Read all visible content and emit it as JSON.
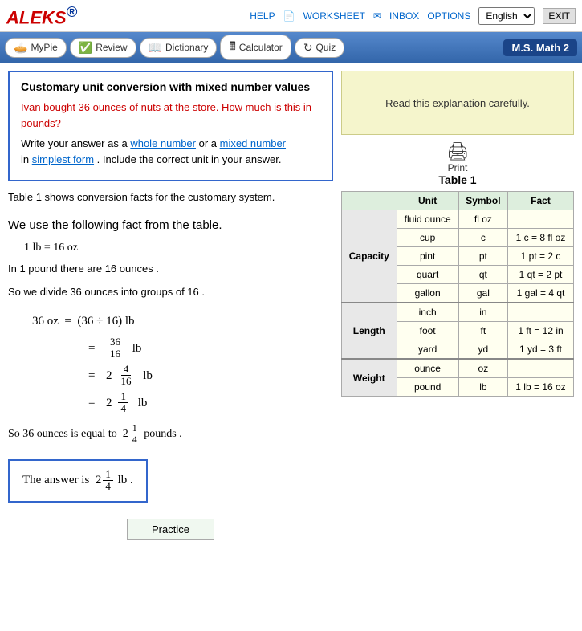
{
  "header": {
    "logo": "ALEKS",
    "logo_superscript": "®",
    "links": {
      "help": "HELP",
      "worksheet": "WORKSHEET",
      "inbox": "INBOX",
      "options": "OPTIONS",
      "exit": "EXIT"
    },
    "language": "English"
  },
  "navbar": {
    "mypie": "MyPie",
    "review": "Review",
    "dictionary": "Dictionary",
    "calculator": "Calculator",
    "quiz": "Quiz",
    "course": "M.S. Math 2"
  },
  "problem": {
    "title": "Customary unit conversion with mixed number values",
    "body": "Ivan bought 36 ounces of nuts at the store. How much is this in pounds?",
    "instruction1": "Write your answer as a",
    "whole_number_link": "whole number",
    "or": "or a",
    "mixed_number_link": "mixed number",
    "instruction2": "in",
    "simplest_form_link": "simplest form",
    "instruction3": ". Include the correct unit in your answer."
  },
  "explanation": {
    "text": "Read this explanation carefully."
  },
  "print": {
    "label": "Print"
  },
  "content": {
    "table_ref": "Table 1 shows conversion facts for the customary system.",
    "fact_intro": "We use the following fact from the table.",
    "fact": "1 lb = 16 oz",
    "line1": "In 1 pound there are 16 ounces .",
    "line2": "So we divide 36 ounces into groups of 16 .",
    "conclusion": "So 36 ounces is equal to",
    "conclusion2": "pounds .",
    "answer_label": "The answer is",
    "answer_unit": "lb .",
    "practice_label": "Practice"
  },
  "table1": {
    "title": "Table 1",
    "headers": [
      "Unit",
      "Symbol",
      "Fact"
    ],
    "categories": {
      "capacity": {
        "label": "Capacity",
        "rows": [
          {
            "unit": "fluid ounce",
            "symbol": "fl oz",
            "fact": ""
          },
          {
            "unit": "cup",
            "symbol": "c",
            "fact": "1 c = 8 fl oz"
          },
          {
            "unit": "pint",
            "symbol": "pt",
            "fact": "1 pt = 2 c"
          },
          {
            "unit": "quart",
            "symbol": "qt",
            "fact": "1 qt = 2 pt"
          },
          {
            "unit": "gallon",
            "symbol": "gal",
            "fact": "1 gal = 4 qt"
          }
        ]
      },
      "length": {
        "label": "Length",
        "rows": [
          {
            "unit": "inch",
            "symbol": "in",
            "fact": ""
          },
          {
            "unit": "foot",
            "symbol": "ft",
            "fact": "1 ft = 12 in"
          },
          {
            "unit": "yard",
            "symbol": "yd",
            "fact": "1 yd = 3 ft"
          }
        ]
      },
      "weight": {
        "label": "Weight",
        "rows": [
          {
            "unit": "ounce",
            "symbol": "oz",
            "fact": ""
          },
          {
            "unit": "pound",
            "symbol": "lb",
            "fact": "1 lb = 16 oz"
          }
        ]
      }
    }
  }
}
